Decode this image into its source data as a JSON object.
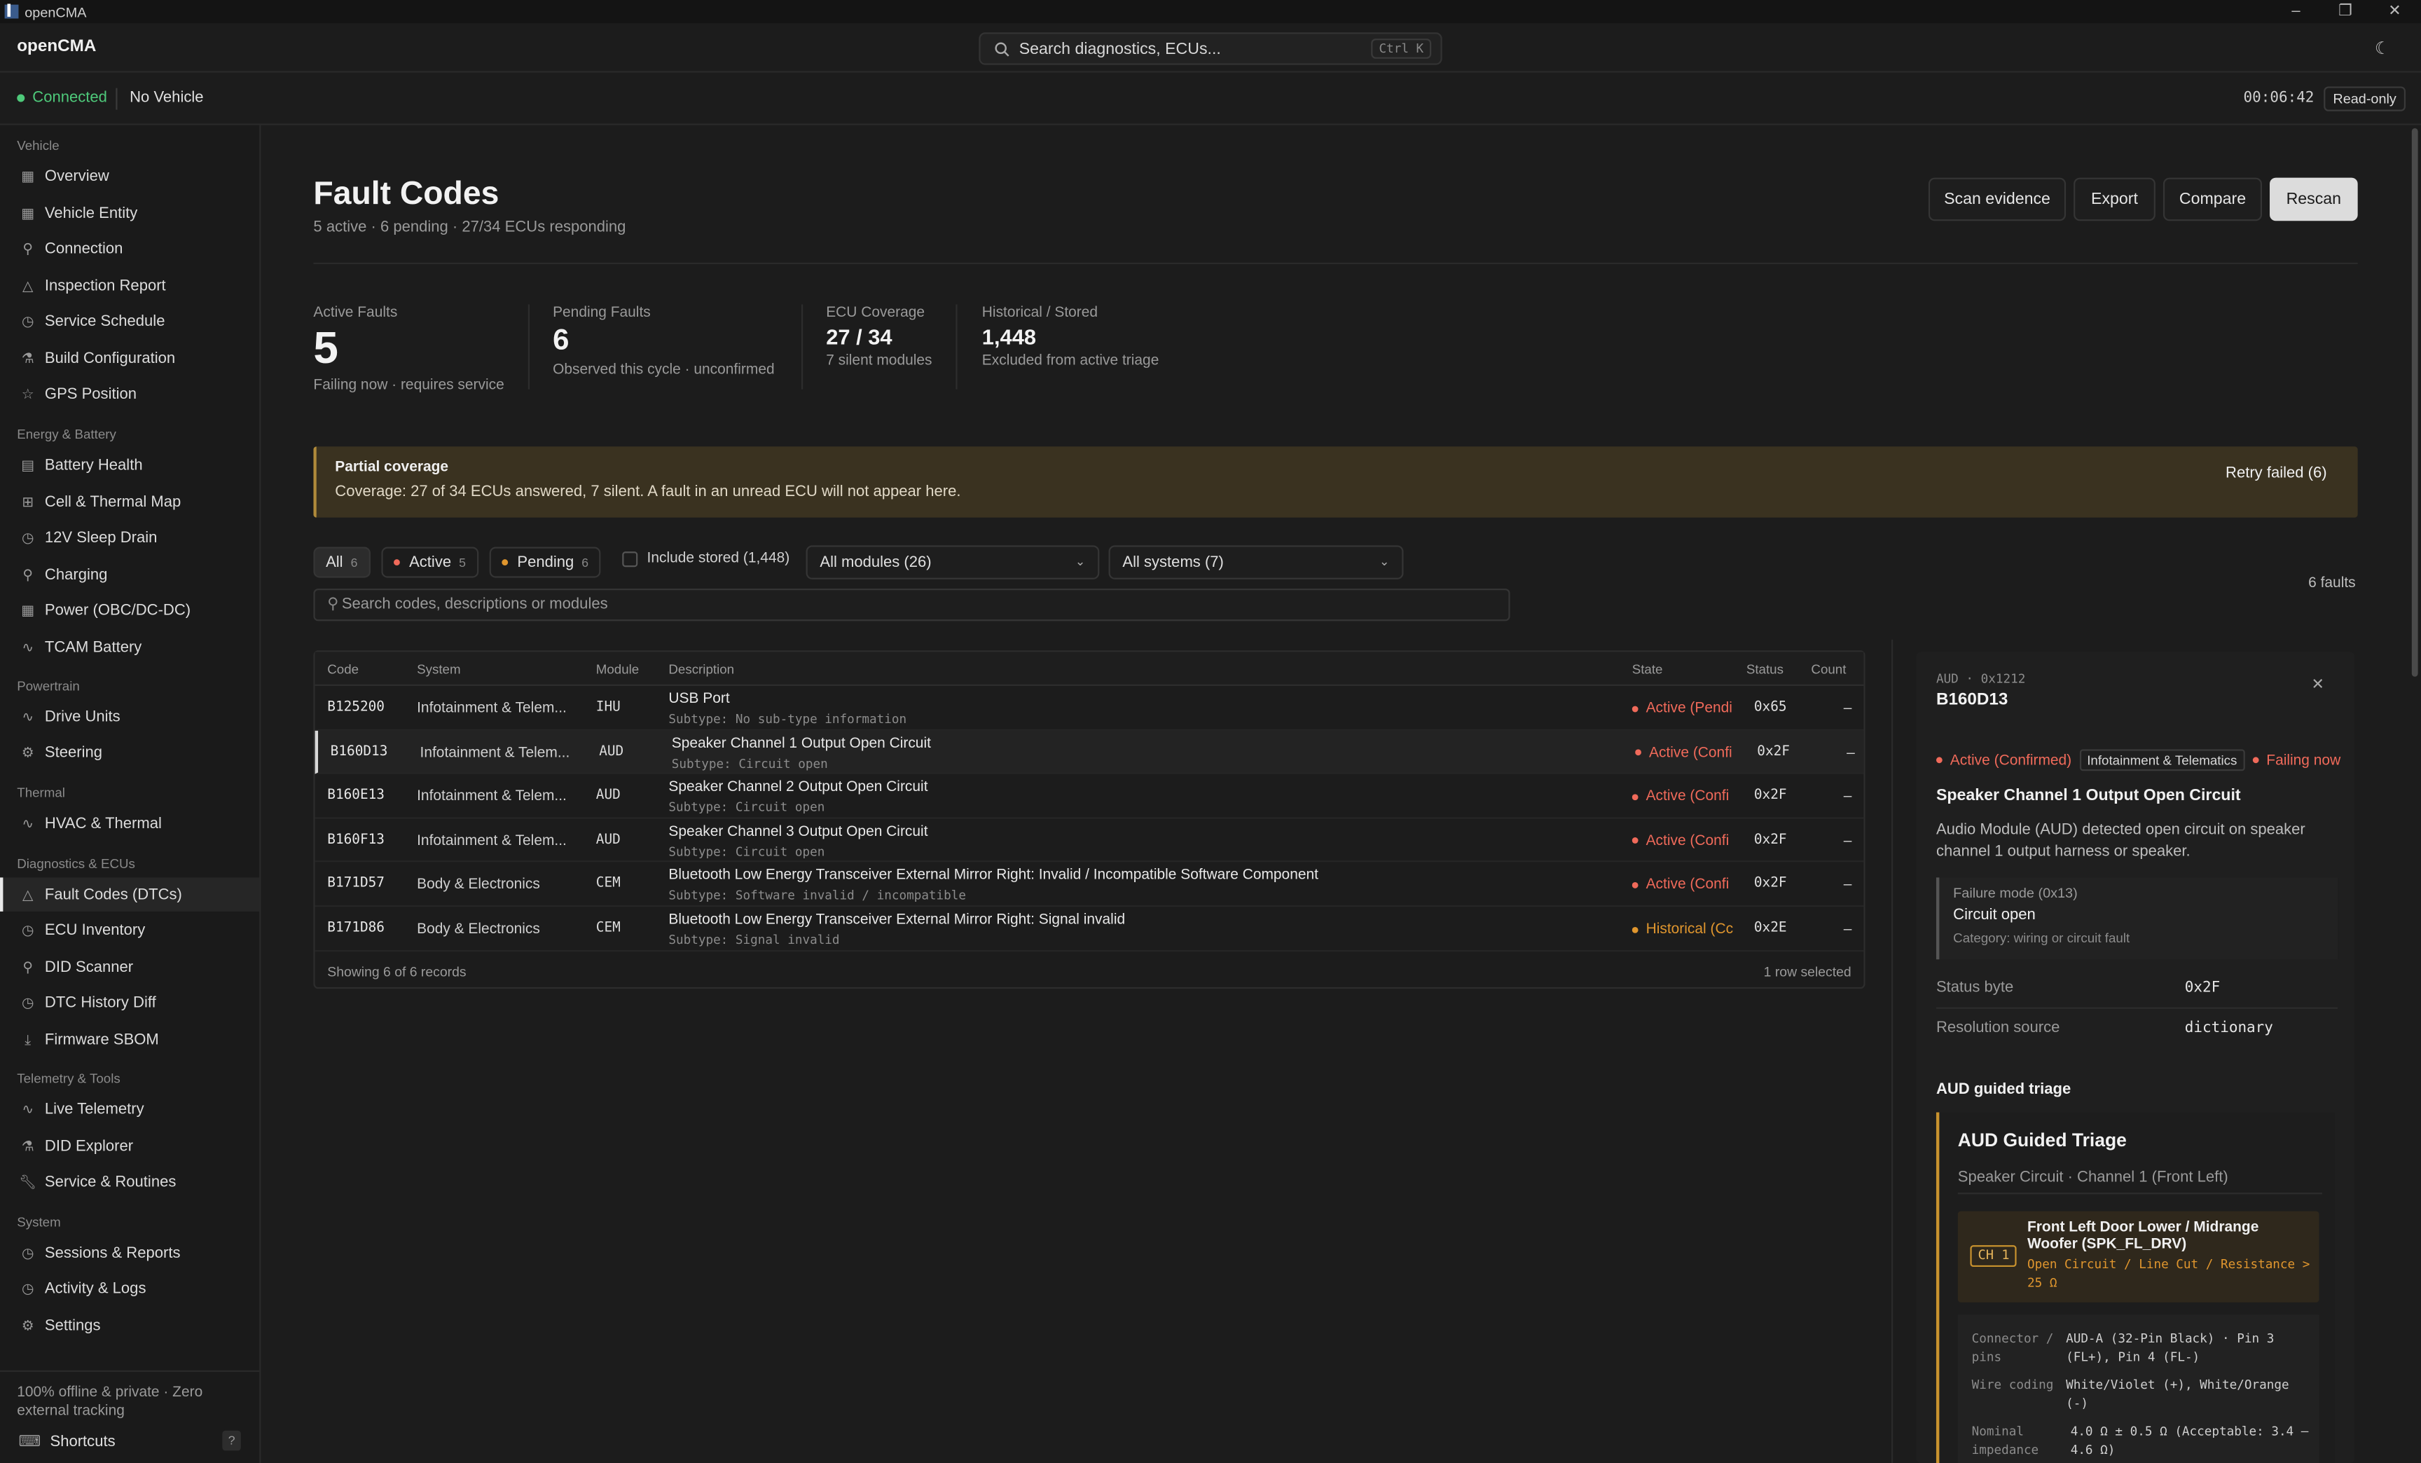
{
  "titlebar": {
    "app": "openCMA"
  },
  "header": {
    "brand": "openCMA",
    "search_placeholder": "Search diagnostics, ECUs...",
    "search_kbd": "Ctrl K"
  },
  "status": {
    "connection": "Connected",
    "vehicle": "No Vehicle",
    "timer": "00:06:42",
    "mode": "Read-only"
  },
  "sidebar": {
    "sections": [
      {
        "label": "Vehicle",
        "items": [
          "Overview",
          "Vehicle Entity",
          "Connection",
          "Inspection Report",
          "Service Schedule",
          "Build Configuration",
          "GPS Position"
        ]
      },
      {
        "label": "Energy & Battery",
        "items": [
          "Battery Health",
          "Cell & Thermal Map",
          "12V Sleep Drain",
          "Charging",
          "Power (OBC/DC-DC)",
          "TCAM Battery"
        ]
      },
      {
        "label": "Powertrain",
        "items": [
          "Drive Units",
          "Steering"
        ]
      },
      {
        "label": "Thermal",
        "items": [
          "HVAC & Thermal"
        ]
      },
      {
        "label": "Diagnostics & ECUs",
        "items": [
          "Fault Codes (DTCs)",
          "ECU Inventory",
          "DID Scanner",
          "DTC History Diff",
          "Firmware SBOM"
        ]
      },
      {
        "label": "Telemetry & Tools",
        "items": [
          "Live Telemetry",
          "DID Explorer",
          "Service & Routines"
        ]
      },
      {
        "label": "System",
        "items": [
          "Sessions & Reports",
          "Activity & Logs",
          "Settings"
        ]
      }
    ],
    "footer": "100% offline & private · Zero external tracking",
    "shortcuts": "Shortcuts",
    "shortcuts_key": "?"
  },
  "page": {
    "title": "Fault Codes",
    "subtitle": "5 active · 6 pending · 27/34 ECUs responding",
    "buttons": {
      "scan": "Scan evidence",
      "export": "Export",
      "compare": "Compare",
      "rescan": "Rescan"
    }
  },
  "stats": [
    {
      "label": "Active Faults",
      "value": "5",
      "sub": "Failing now · requires service"
    },
    {
      "label": "Pending Faults",
      "value": "6",
      "sub": "Observed this cycle · unconfirmed"
    },
    {
      "label": "ECU Coverage",
      "value": "27 / 34",
      "sub": "7 silent modules"
    },
    {
      "label": "Historical / Stored",
      "value": "1,448",
      "sub": "Excluded from active triage"
    }
  ],
  "banner": {
    "title": "Partial coverage",
    "text": "Coverage: 27 of 34 ECUs answered, 7 silent. A fault in an unread ECU will not appear here.",
    "retry": "Retry failed (6)"
  },
  "filters": {
    "all": "All",
    "all_n": "6",
    "active": "Active",
    "active_n": "5",
    "pending": "Pending",
    "pending_n": "6",
    "stored": "Include stored (1,448)",
    "modules": "All modules (26)",
    "systems": "All systems (7)",
    "count": "6 faults",
    "search_placeholder": "Search codes, descriptions or modules"
  },
  "table": {
    "headers": {
      "code": "Code",
      "system": "System",
      "module": "Module",
      "description": "Description",
      "state": "State",
      "status": "Status",
      "count": "Count"
    },
    "rows": [
      {
        "code": "B125200",
        "system": "Infotainment & Telem...",
        "module": "IHU",
        "desc": "USB Port",
        "subtype": "Subtype: No sub-type information",
        "state": "Active (Pendi",
        "status": "0x65",
        "count": "–"
      },
      {
        "code": "B160D13",
        "system": "Infotainment & Telem...",
        "module": "AUD",
        "desc": "Speaker Channel 1 Output Open Circuit",
        "subtype": "Subtype: Circuit open",
        "state": "Active (Confi",
        "status": "0x2F",
        "count": "–"
      },
      {
        "code": "B160E13",
        "system": "Infotainment & Telem...",
        "module": "AUD",
        "desc": "Speaker Channel 2 Output Open Circuit",
        "subtype": "Subtype: Circuit open",
        "state": "Active (Confi",
        "status": "0x2F",
        "count": "–"
      },
      {
        "code": "B160F13",
        "system": "Infotainment & Telem...",
        "module": "AUD",
        "desc": "Speaker Channel 3 Output Open Circuit",
        "subtype": "Subtype: Circuit open",
        "state": "Active (Confi",
        "status": "0x2F",
        "count": "–"
      },
      {
        "code": "B171D57",
        "system": "Body & Electronics",
        "module": "CEM",
        "desc": "Bluetooth Low Energy Transceiver External Mirror Right: Invalid / Incompatible Software Component",
        "subtype": "Subtype: Software invalid / incompatible",
        "state": "Active (Confi",
        "status": "0x2F",
        "count": "–"
      },
      {
        "code": "B171D86",
        "system": "Body & Electronics",
        "module": "CEM",
        "desc": "Bluetooth Low Energy Transceiver External Mirror Right: Signal invalid",
        "subtype": "Subtype: Signal invalid",
        "state": "Historical (Cc",
        "status": "0x2E",
        "count": "–"
      }
    ],
    "footer_left": "Showing 6 of 6 records",
    "footer_right": "1 row selected"
  },
  "detail": {
    "id": "AUD · 0x1212",
    "code": "B160D13",
    "state": "Active (Confirmed)",
    "system": "Infotainment & Telematics",
    "failing": "Failing now",
    "title": "Speaker Channel 1 Output Open Circuit",
    "description": "Audio Module (AUD) detected open circuit on speaker channel 1 output harness or speaker.",
    "failure_mode_label": "Failure mode (0x13)",
    "failure_mode": "Circuit open",
    "failure_category": "Category: wiring or circuit fault",
    "status_byte_label": "Status byte",
    "status_byte": "0x2F",
    "resolution_label": "Resolution source",
    "resolution": "dictionary",
    "triage_heading": "AUD guided triage",
    "triage_title": "AUD Guided Triage",
    "triage_sub": "Speaker Circuit · Channel 1 (Front Left)",
    "channel_tag": "CH 1",
    "channel_name": "Front Left Door Lower / Midrange Woofer (SPK_FL_DRV)",
    "channel_error": "Open Circuit / Line Cut / Resistance > 25 Ω",
    "specs": [
      {
        "k": "Connector / pins",
        "v": "AUD-A (32-Pin Black) · Pin 3 (FL+), Pin 4 (FL-)"
      },
      {
        "k": "Wire coding",
        "v": "White/Violet (+), White/Orange (-)"
      },
      {
        "k": "Nominal impedance",
        "v": "4.0 Ω ± 0.5 Ω (Acceptable: 3.4 – 4.6 Ω)"
      }
    ]
  },
  "colors": {
    "accent": "#e8e8e8",
    "active_red": "#f06a5a",
    "pending_orange": "#e0962e",
    "connected_green": "#4ec97a",
    "warning_bg": "#3a3220"
  }
}
